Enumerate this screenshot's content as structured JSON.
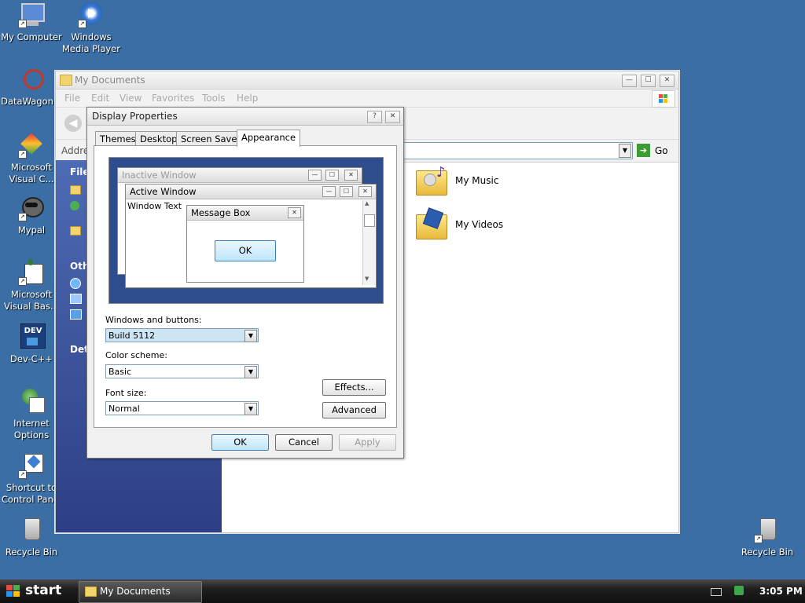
{
  "desktop": {
    "icons": [
      {
        "label1": "My Computer",
        "label2": ""
      },
      {
        "label1": "Windows",
        "label2": "Media Player"
      },
      {
        "label1": "DataWagon...",
        "label2": ""
      },
      {
        "label1": "Microsoft",
        "label2": "Visual C..."
      },
      {
        "label1": "Mypal",
        "label2": ""
      },
      {
        "label1": "Microsoft",
        "label2": "Visual Bas..."
      },
      {
        "label1": "Dev-C++",
        "label2": ""
      },
      {
        "label1": "Internet",
        "label2": "Options"
      },
      {
        "label1": "Shortcut to",
        "label2": "Control Panel"
      },
      {
        "label1": "Recycle Bin",
        "label2": ""
      },
      {
        "label1": "Recycle Bin",
        "label2": ""
      }
    ]
  },
  "explorer": {
    "title": "My Documents",
    "menu": [
      "File",
      "Edit",
      "View",
      "Favorites",
      "Tools",
      "Help"
    ],
    "address_label": "Address",
    "go_label": "Go",
    "left_headers": [
      "File",
      "Oth",
      "Det"
    ],
    "items": [
      {
        "label": "My Music",
        "icon": "music-folder-icon"
      },
      {
        "label": "My Videos",
        "icon": "video-folder-icon"
      }
    ]
  },
  "dialog": {
    "title": "Display Properties",
    "help_glyph": "?",
    "close_glyph": "✕",
    "tabs": [
      "Themes",
      "Desktop",
      "Screen Saver",
      "Appearance"
    ],
    "preview": {
      "inactive_title": "Inactive Window",
      "active_title": "Active Window",
      "window_text": "Window Text",
      "message_title": "Message Box",
      "message_ok": "OK"
    },
    "windows_buttons_label": "Windows and buttons:",
    "windows_buttons_value": "Build 5112",
    "color_scheme_label": "Color scheme:",
    "color_scheme_value": "Basic",
    "font_size_label": "Font size:",
    "font_size_value": "Normal",
    "effects_label": "Effects...",
    "advanced_label": "Advanced",
    "ok_label": "OK",
    "cancel_label": "Cancel",
    "apply_label": "Apply"
  },
  "taskbar": {
    "start_label": "start",
    "task_label": "My Documents",
    "clock": "3:05 PM"
  },
  "colors": {
    "desktop": "#3a6ea5",
    "left_pane": "#2d3f84",
    "accent": "#3c7fb1"
  }
}
